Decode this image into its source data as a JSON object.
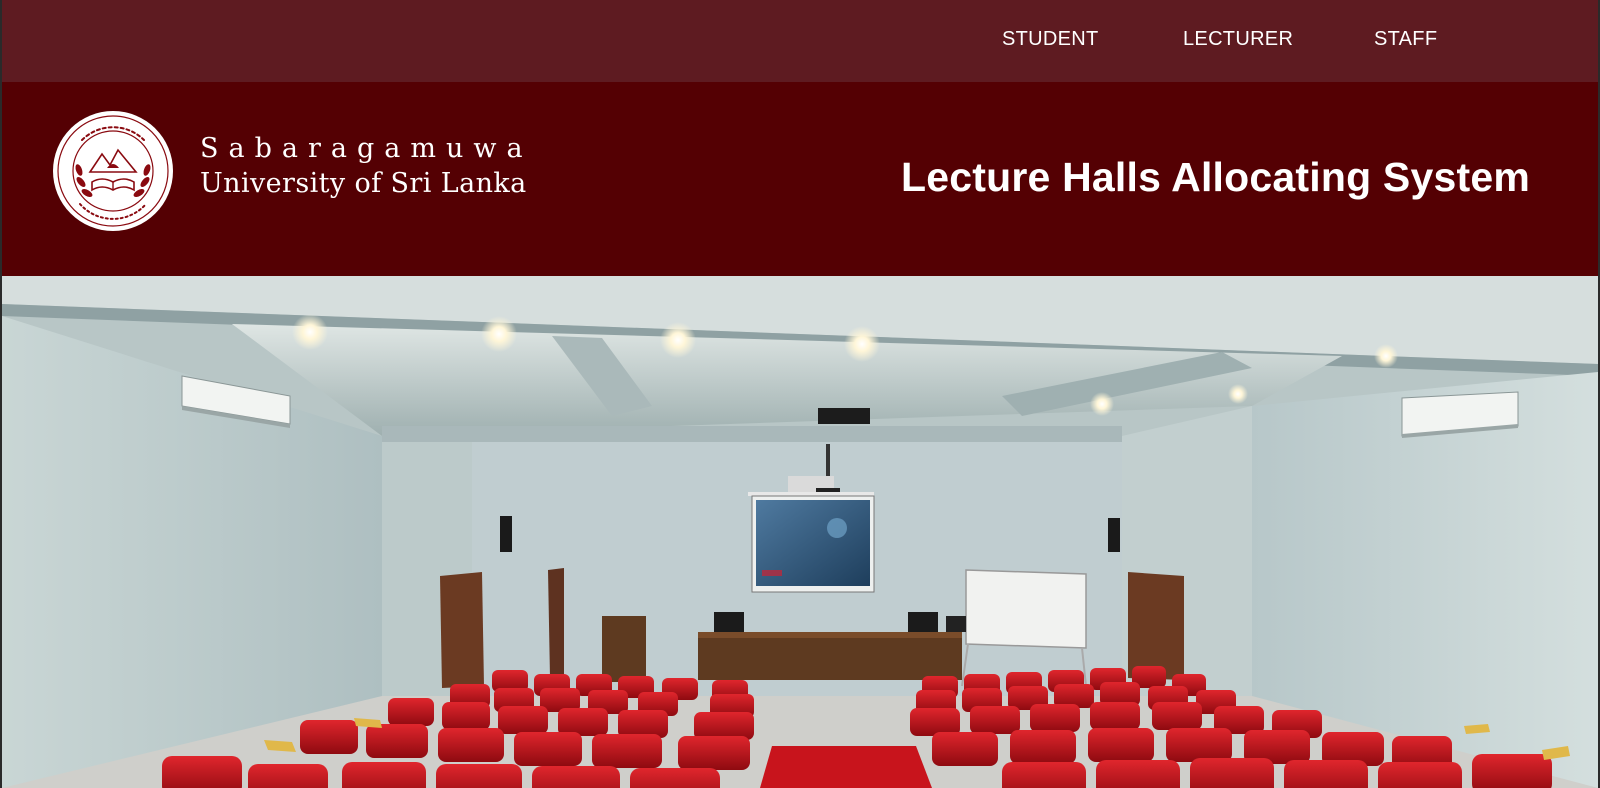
{
  "nav": {
    "student": "STUDENT",
    "lecturer": "LECTURER",
    "staff": "STAFF"
  },
  "header": {
    "university_line1": "Sabaragamuwa",
    "university_line2": "University of Sri Lanka",
    "system_title": "Lecture Halls Allocating System",
    "logo_icon": "university-seal-icon"
  },
  "hero": {
    "image": "lecture-hall-photo"
  },
  "colors": {
    "nav_bg": "#5e1b21",
    "header_bg": "#540003",
    "text": "#ffffff",
    "seat_red": "#c8141c"
  }
}
